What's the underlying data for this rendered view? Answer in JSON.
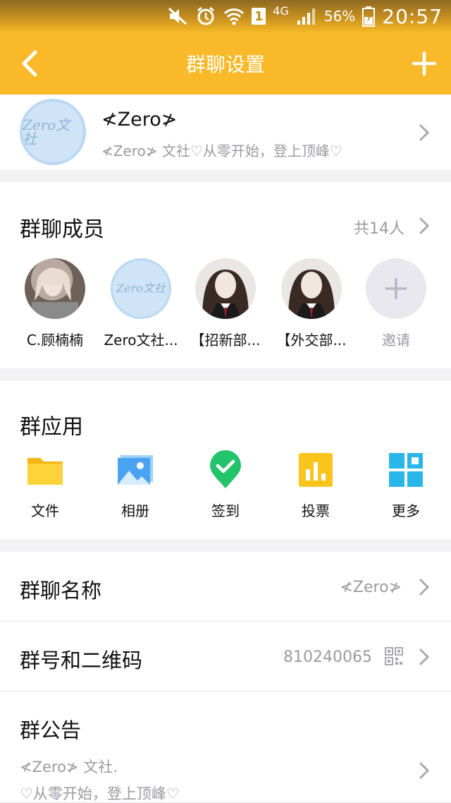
{
  "status_bar": {
    "network": "4G",
    "sim_slot": "1",
    "battery": "56%",
    "time": "20:57"
  },
  "nav": {
    "title": "群聊设置"
  },
  "group": {
    "name": "≮Zero≯",
    "description": "≮Zero≯ 文社♡从零开始，登上顶峰♡",
    "avatar_logo": "Zero文社"
  },
  "members": {
    "title": "群聊成员",
    "count": "共14人",
    "list": [
      {
        "name": "C.顾楠楠"
      },
      {
        "name": "Zero文社..."
      },
      {
        "name": "【招新部..."
      },
      {
        "name": "【外交部..."
      }
    ],
    "invite_label": "邀请"
  },
  "apps": {
    "title": "群应用",
    "items": [
      {
        "label": "文件",
        "icon": "folder-icon",
        "color": "#f9c51d"
      },
      {
        "label": "相册",
        "icon": "photo-album-icon",
        "color": "#4aa3f0"
      },
      {
        "label": "签到",
        "icon": "check-in-icon",
        "color": "#22c36a"
      },
      {
        "label": "投票",
        "icon": "vote-chart-icon",
        "color": "#f9c51d"
      },
      {
        "label": "更多",
        "icon": "grid-more-icon",
        "color": "#29b6e8"
      }
    ]
  },
  "settings": {
    "group_name_label": "群聊名称",
    "group_name_value": "≮Zero≯",
    "group_id_label": "群号和二维码",
    "group_id_value": "810240065",
    "notice_label": "群公告",
    "notice_text": "≮Zero≯ 文社.\n♡从零开始，登上顶峰♡"
  },
  "colors": {
    "accent": "#f9b928",
    "muted_text": "#9a9aa2"
  }
}
